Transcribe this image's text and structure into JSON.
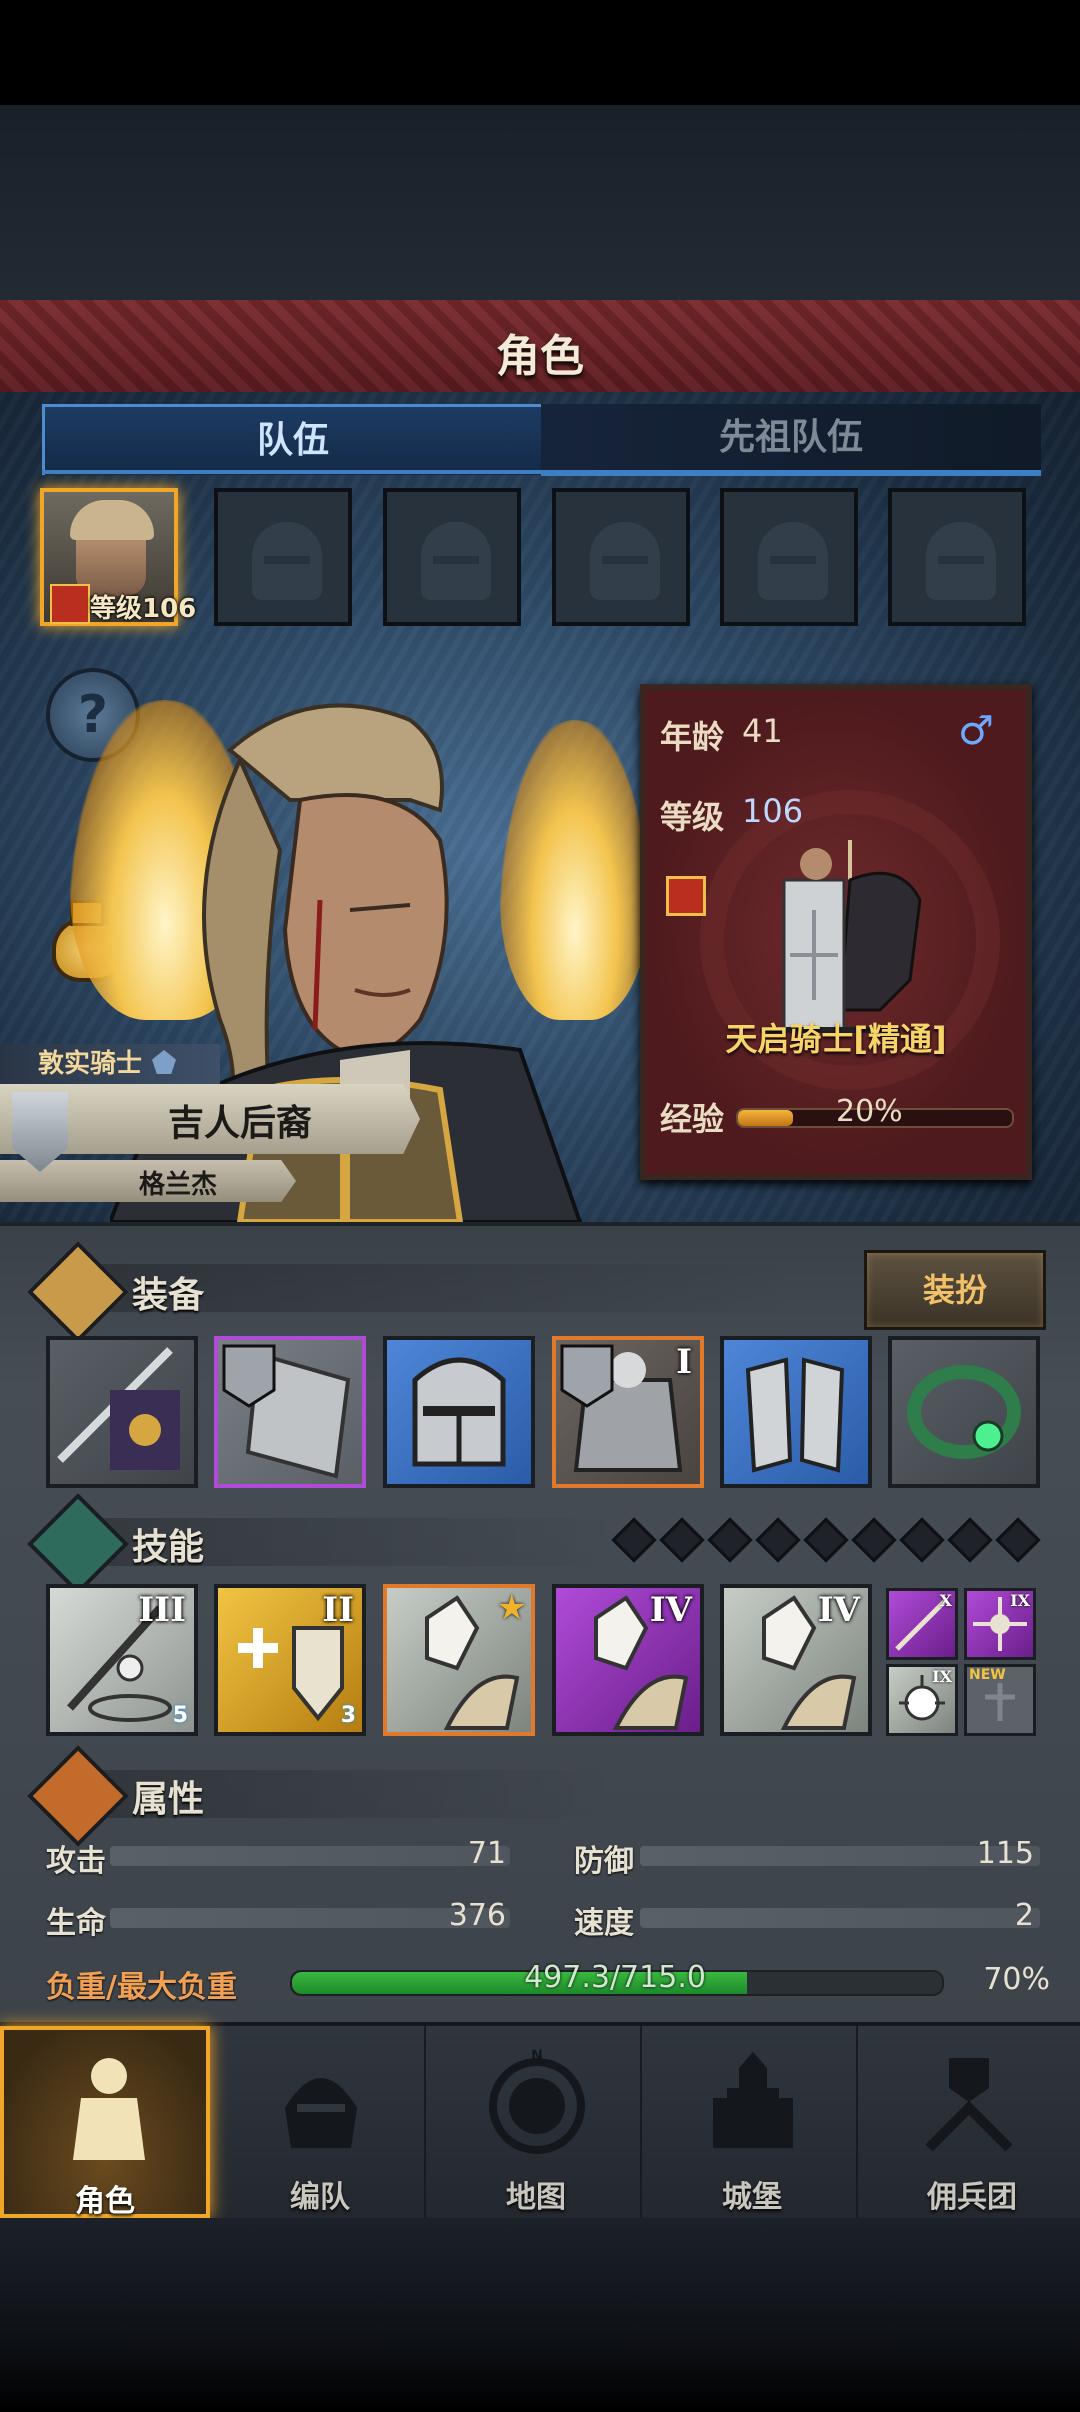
{
  "header": {
    "title": "角色"
  },
  "tabs": [
    {
      "label": "队伍",
      "active": true
    },
    {
      "label": "先祖队伍",
      "active": false
    }
  ],
  "roster": {
    "active_slot_level_label": "等级106",
    "empty_slots": 5
  },
  "hero": {
    "title": "敦实骑士",
    "name": "吉人后裔",
    "subname": "格兰杰",
    "age_label": "年龄",
    "age": "41",
    "gender_icon": "male-icon",
    "level_label": "等级",
    "level": "106",
    "class_name": "天启骑士[精通]",
    "exp_label": "经验",
    "exp_percent_text": "20%",
    "exp_fraction": 0.2
  },
  "equipment": {
    "label": "装备",
    "dress_button": "装扮",
    "items": [
      {
        "icon": "banner-lance-icon",
        "rarity": "common"
      },
      {
        "icon": "tower-shield-icon",
        "rarity": "epic"
      },
      {
        "icon": "great-helm-icon",
        "rarity": "rare"
      },
      {
        "icon": "plate-armor-icon",
        "rarity": "legendary",
        "tier": "I"
      },
      {
        "icon": "greaves-icon",
        "rarity": "rare"
      },
      {
        "icon": "emerald-ring-icon",
        "rarity": "common"
      }
    ]
  },
  "skills": {
    "label": "技能",
    "slot_gems": 9,
    "items": [
      {
        "icon": "spear-aura-icon",
        "tier": "III",
        "badge": "5",
        "rarity": "common"
      },
      {
        "icon": "holy-shield-icon",
        "tier": "II",
        "badge": "3",
        "rarity": "gold"
      },
      {
        "icon": "crystal-fist-icon",
        "tier": "",
        "star": true,
        "rarity": "legendary"
      },
      {
        "icon": "crystal-fist-icon",
        "tier": "IV",
        "rarity": "epic"
      },
      {
        "icon": "crystal-fist-icon",
        "tier": "IV",
        "rarity": "common"
      }
    ],
    "passives": [
      {
        "icon": "spear-icon",
        "tier": "X",
        "rarity": "epic"
      },
      {
        "icon": "compass-star-icon",
        "tier": "IX",
        "rarity": "epic"
      },
      {
        "icon": "burst-icon",
        "tier": "IX",
        "rarity": "common"
      },
      {
        "icon": "cross-icon",
        "tier": "",
        "new_label": "NEW",
        "rarity": "locked"
      }
    ]
  },
  "attributes": {
    "label": "属性",
    "attack_label": "攻击",
    "attack": "71",
    "defense_label": "防御",
    "defense": "115",
    "hp_label": "生命",
    "hp": "376",
    "speed_label": "速度",
    "speed": "2",
    "load_label": "负重/最大负重",
    "load_text": "497.3/715.0",
    "load_percent_text": "70%",
    "load_fraction": 0.7
  },
  "nav": [
    {
      "label": "角色",
      "icon": "knight-icon",
      "active": true
    },
    {
      "label": "编队",
      "icon": "helmet-icon",
      "active": false
    },
    {
      "label": "地图",
      "icon": "compass-map-icon",
      "active": false
    },
    {
      "label": "城堡",
      "icon": "castle-icon",
      "active": false
    },
    {
      "label": "佣兵团",
      "icon": "mercenary-icon",
      "active": false
    }
  ],
  "colors": {
    "accent_orange": "#f0a629",
    "tab_blue": "#3e7fc4",
    "panel_red": "#5e1c21",
    "load_green": "#39b83f",
    "epic_purple": "#b04bd8",
    "rare_blue": "#4f86d8",
    "legendary_orange": "#e07a2a"
  }
}
